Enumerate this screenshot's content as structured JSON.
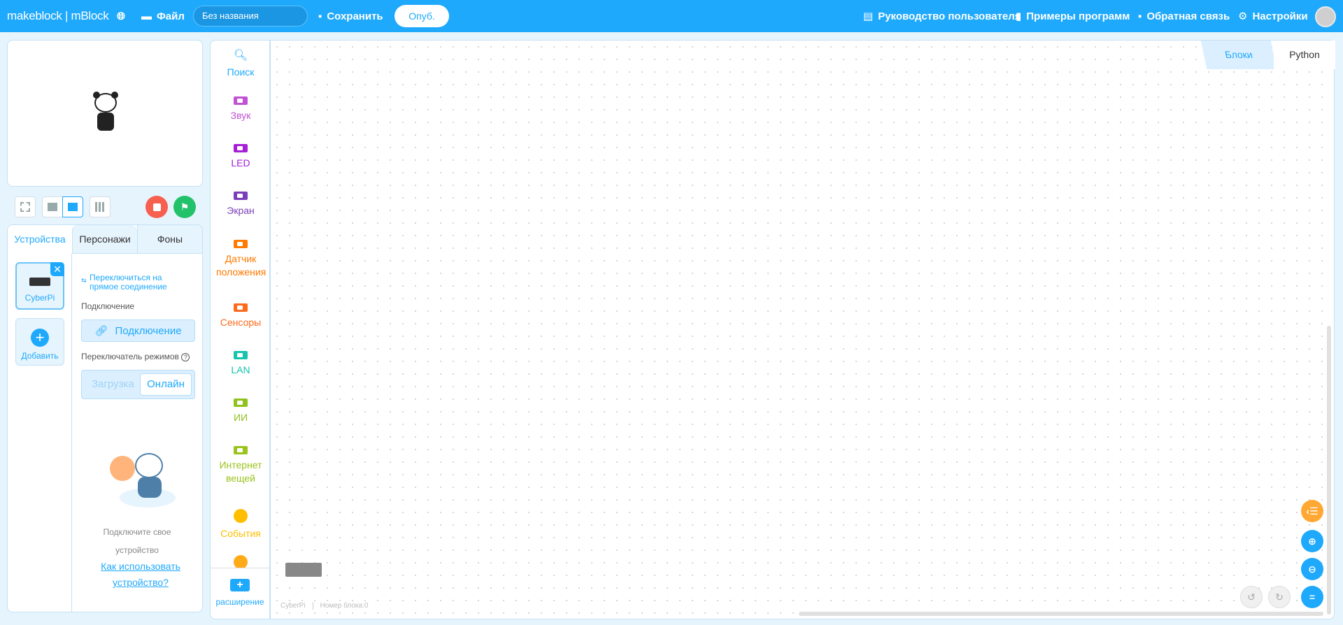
{
  "header": {
    "logo": "makeblock | mBlock",
    "file": "Файл",
    "project_name": "Без названия",
    "save": "Сохранить",
    "publish": "Опуб.",
    "guide": "Руководство пользователя",
    "examples": "Примеры программ",
    "feedback": "Обратная связь",
    "settings": "Настройки"
  },
  "sprite_panel": {
    "tabs": [
      "Устройства",
      "Персонажи",
      "Фоны"
    ],
    "device_name": "CyberPi",
    "add_label": "Добавить",
    "switch_link": "Переключиться на прямое соединение",
    "connection_label": "Подключение",
    "connect_button": "Подключение",
    "mode_label": "Переключатель режимов",
    "mode_upload": "Загрузка",
    "mode_live": "Онлайн",
    "empty_text_1": "Подключите свое",
    "empty_text_2": "устройство",
    "help_link": "Как использовать устройство?"
  },
  "categories": [
    {
      "label": "Поиск",
      "color": "#1fa9fc"
    },
    {
      "label": "Звук",
      "color": "#c152d4"
    },
    {
      "label": "LED",
      "color": "#a51ed8"
    },
    {
      "label": "Экран",
      "color": "#7a3fb8"
    },
    {
      "label": "Датчик положения",
      "color": "#ff7a00"
    },
    {
      "label": "Сенсоры",
      "color": "#ff6a1a"
    },
    {
      "label": "LAN",
      "color": "#17c4ae"
    },
    {
      "label": "ИИ",
      "color": "#8fc21f"
    },
    {
      "label": "Интернет вещей",
      "color": "#9ac31c"
    },
    {
      "label": "События",
      "color": "#ffbf00"
    }
  ],
  "extension": "расширение",
  "editor": {
    "tab_blocks": "Блоки",
    "tab_python": "Python",
    "footer_device": "CyberPi",
    "footer_blocks": "Номер блока:0"
  }
}
